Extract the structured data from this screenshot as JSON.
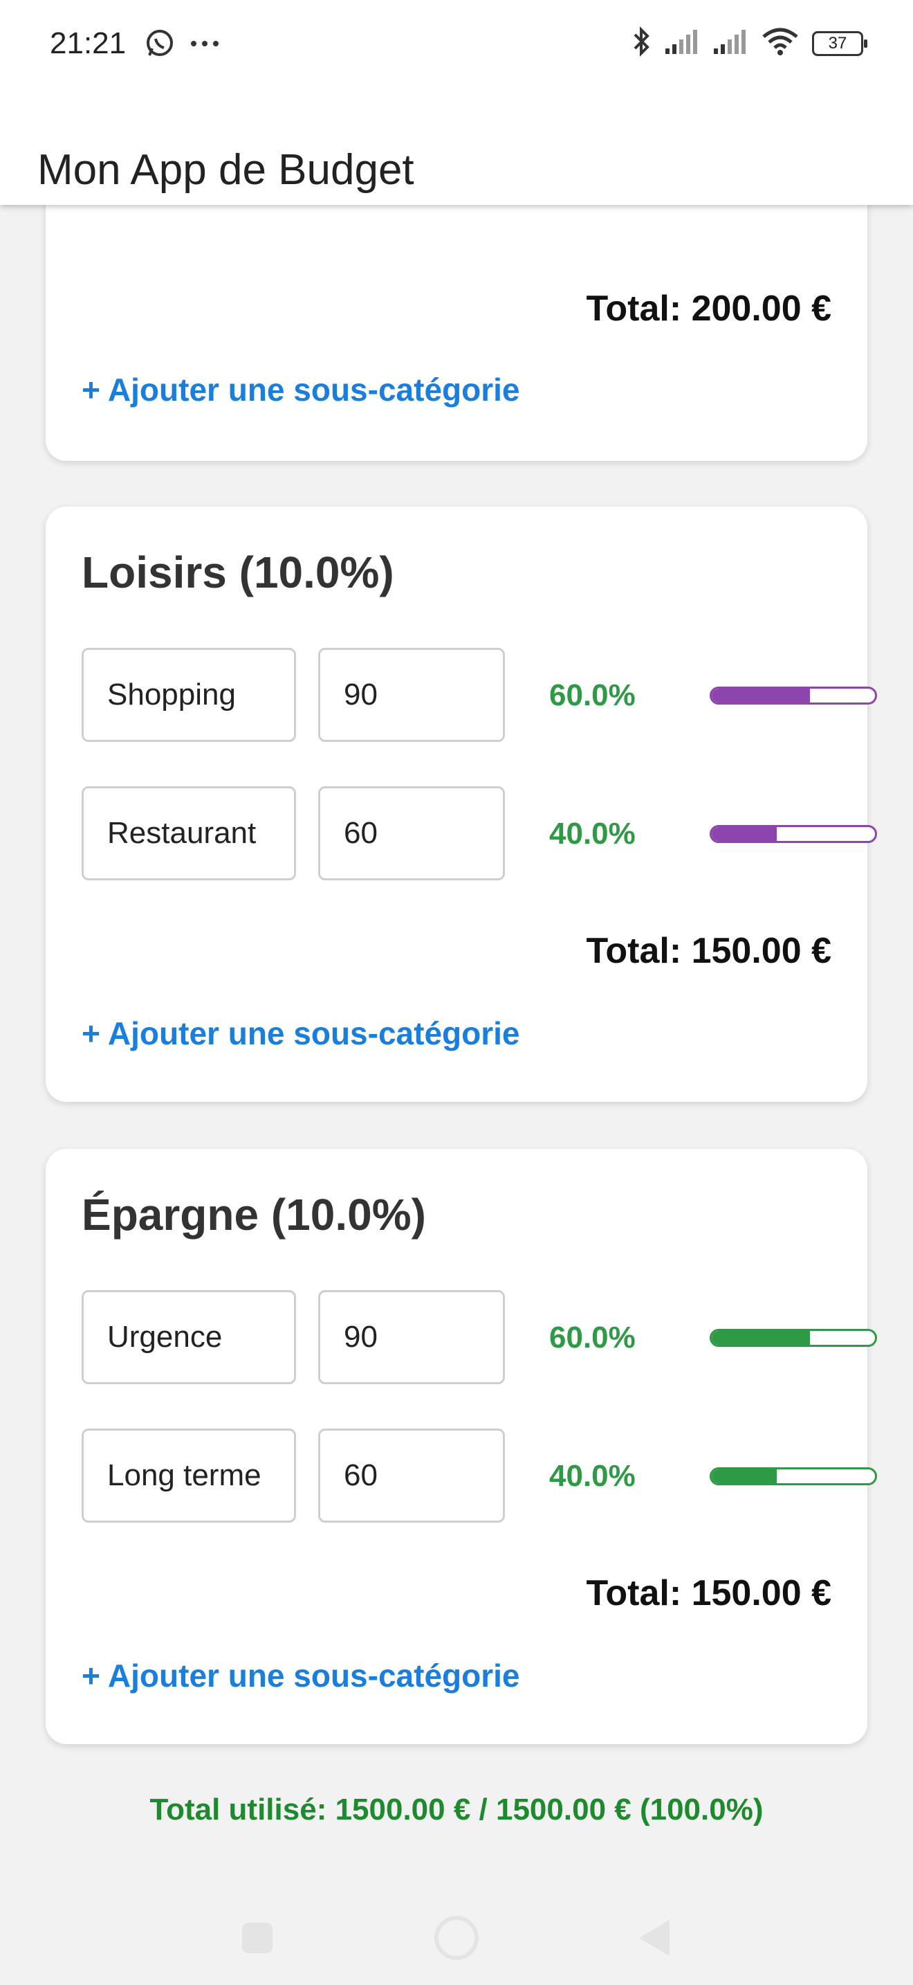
{
  "status": {
    "time": "21:21",
    "battery": "37",
    "icons": [
      "whatsapp-icon",
      "more-icon",
      "bluetooth-icon",
      "signal-icon",
      "signal-icon",
      "wifi-icon",
      "battery-icon"
    ]
  },
  "app": {
    "title": "Mon App de Budget"
  },
  "colors": {
    "loisirs": "#8e44ad",
    "epargne": "#2e9a45",
    "link": "#1a7fdc",
    "grand_total": "#1e8a2e"
  },
  "categories": [
    {
      "title": "",
      "rows": [],
      "total": "Total: 200.00 €",
      "add_label": "+ Ajouter une sous-catégorie"
    },
    {
      "title": "Loisirs (10.0%)",
      "rows": [
        {
          "name": "Shopping",
          "amount": "90",
          "pct": "60.0%",
          "fraction": 0.6
        },
        {
          "name": "Restaurant",
          "amount": "60",
          "pct": "40.0%",
          "fraction": 0.4
        }
      ],
      "total": "Total: 150.00 €",
      "add_label": "+ Ajouter une sous-catégorie"
    },
    {
      "title": "Épargne (10.0%)",
      "rows": [
        {
          "name": "Urgence",
          "amount": "90",
          "pct": "60.0%",
          "fraction": 0.6
        },
        {
          "name": "Long terme",
          "amount": "60",
          "pct": "40.0%",
          "fraction": 0.4
        }
      ],
      "total": "Total: 150.00 €",
      "add_label": "+ Ajouter une sous-catégorie"
    }
  ],
  "grand_total": "Total utilisé: 1500.00 € / 1500.00 € (100.0%)",
  "nav": [
    "recents-icon",
    "home-icon",
    "back-icon"
  ]
}
